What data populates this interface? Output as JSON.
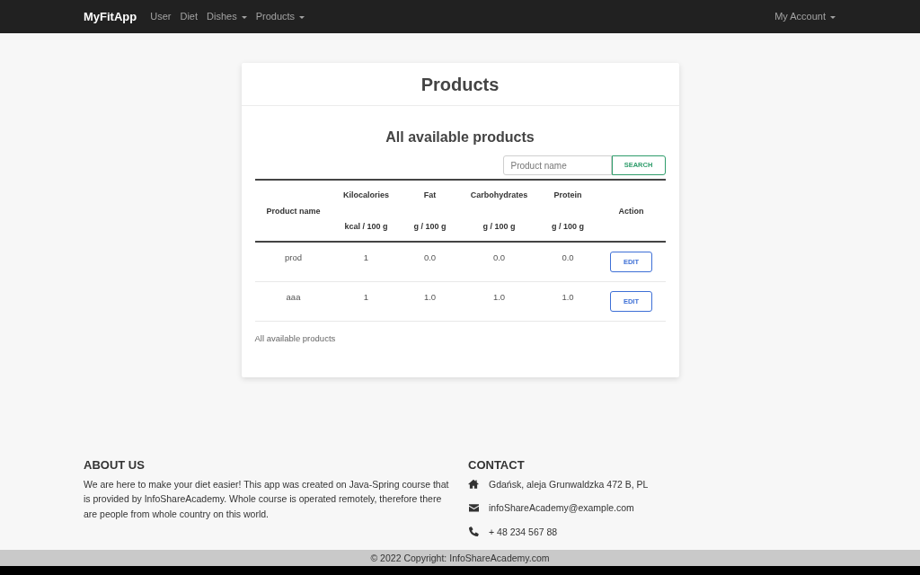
{
  "navbar": {
    "brand": "MyFitApp",
    "links": [
      {
        "label": "User",
        "dropdown": false
      },
      {
        "label": "Diet",
        "dropdown": false
      },
      {
        "label": "Dishes",
        "dropdown": true
      },
      {
        "label": "Products",
        "dropdown": true
      }
    ],
    "account": {
      "label": "My Account",
      "dropdown": true
    }
  },
  "card": {
    "title": "Products",
    "subtitle": "All available products",
    "search": {
      "placeholder": "Product name",
      "button": "SEARCH"
    },
    "table": {
      "columns": [
        {
          "name": "Product name"
        },
        {
          "name": "Kilocalories",
          "unit": "kcal / 100 g"
        },
        {
          "name": "Fat",
          "unit": "g / 100 g"
        },
        {
          "name": "Carbohydrates",
          "unit": "g / 100 g"
        },
        {
          "name": "Protein",
          "unit": "g / 100 g"
        },
        {
          "name": "Action"
        }
      ],
      "rows": [
        {
          "cells": [
            "prod",
            "1",
            "0.0",
            "0.0",
            "0.0"
          ],
          "action": "EDIT"
        },
        {
          "cells": [
            "aaa",
            "1",
            "1.0",
            "1.0",
            "1.0"
          ],
          "action": "EDIT"
        }
      ],
      "caption": "All available products"
    }
  },
  "footer": {
    "about": {
      "title": "ABOUT US",
      "text": "We are here to make your diet easier! This app was created on Java-Spring course that is provided by InfoShareAcademy. Whole course is operated remotely, therefore there are people from whole country on this world."
    },
    "contact": {
      "title": "CONTACT",
      "items": [
        {
          "kind": "address",
          "text": "Gdańsk, aleja Grunwaldzka 472 B, PL"
        },
        {
          "kind": "email",
          "text": "infoShareAcademy@example.com"
        },
        {
          "kind": "phone",
          "text": "+ 48 234 567 88"
        }
      ]
    },
    "copyright": {
      "text": "© 2022 Copyright:",
      "link": "InfoShareAcademy.com"
    }
  }
}
